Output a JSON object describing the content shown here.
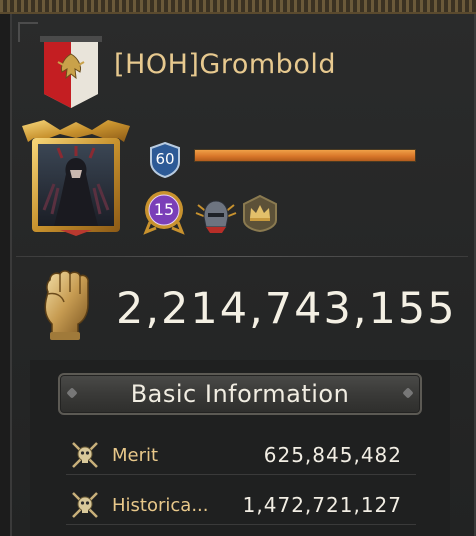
{
  "player": {
    "name": "[HOH]Grombold",
    "level": "60",
    "level_progress": 1.0,
    "vip_level": "15"
  },
  "power": {
    "value": "2,214,743,155",
    "icon": "fist-icon"
  },
  "info": {
    "header": "Basic Information",
    "rows": [
      {
        "label": "Merit",
        "value": "625,845,482",
        "icon": "skull-crest-icon"
      },
      {
        "label": "Historica...",
        "value": "1,472,721,127",
        "icon": "skull-crest-icon"
      }
    ]
  },
  "colors": {
    "name_gold": "#e7c98f",
    "label_gold": "#e8c88a",
    "xp_orange": "#d9772a",
    "banner_red": "#c41e22"
  }
}
